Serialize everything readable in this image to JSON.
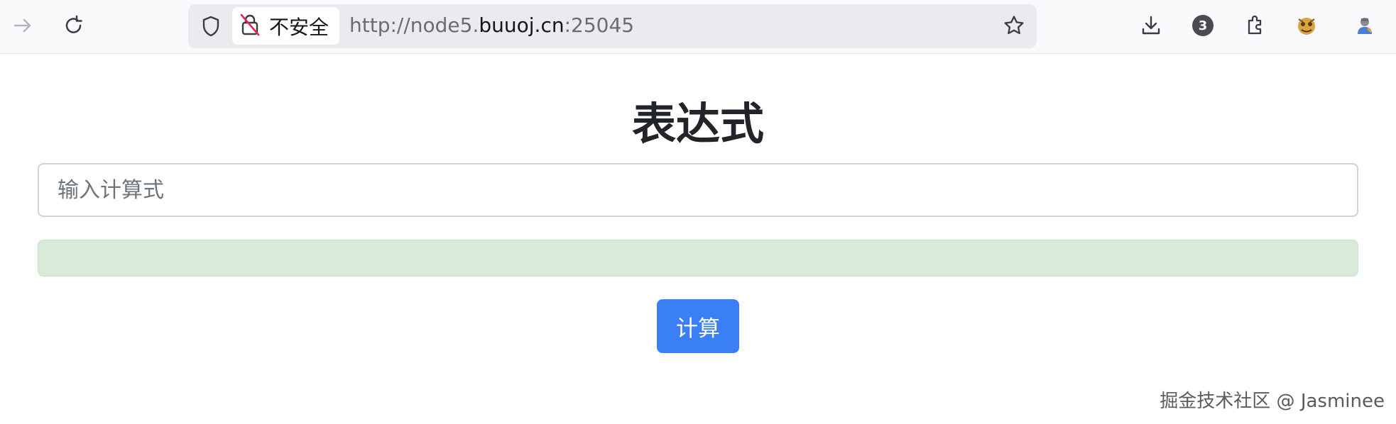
{
  "browser": {
    "security_label": "不安全",
    "url": {
      "scheme": "http://node5.",
      "host": "buuoj.cn",
      "port": ":25045"
    },
    "notification_count": "3",
    "icons": [
      "forward-icon",
      "reload-icon",
      "shield-icon",
      "insecure-lock-icon",
      "bookmark-star-icon",
      "download-icon",
      "extensions-icon",
      "extension-avatar-icon",
      "profile-avatar-icon"
    ]
  },
  "page": {
    "title": "表达式",
    "input": {
      "placeholder": "输入计算式",
      "value": ""
    },
    "result": "",
    "button_label": "计算"
  },
  "watermark": "掘金技术社区 @ Jasminee",
  "colors": {
    "button": "#3a7ff6",
    "alert_bg": "#d8ebd9",
    "title": "#212529"
  }
}
